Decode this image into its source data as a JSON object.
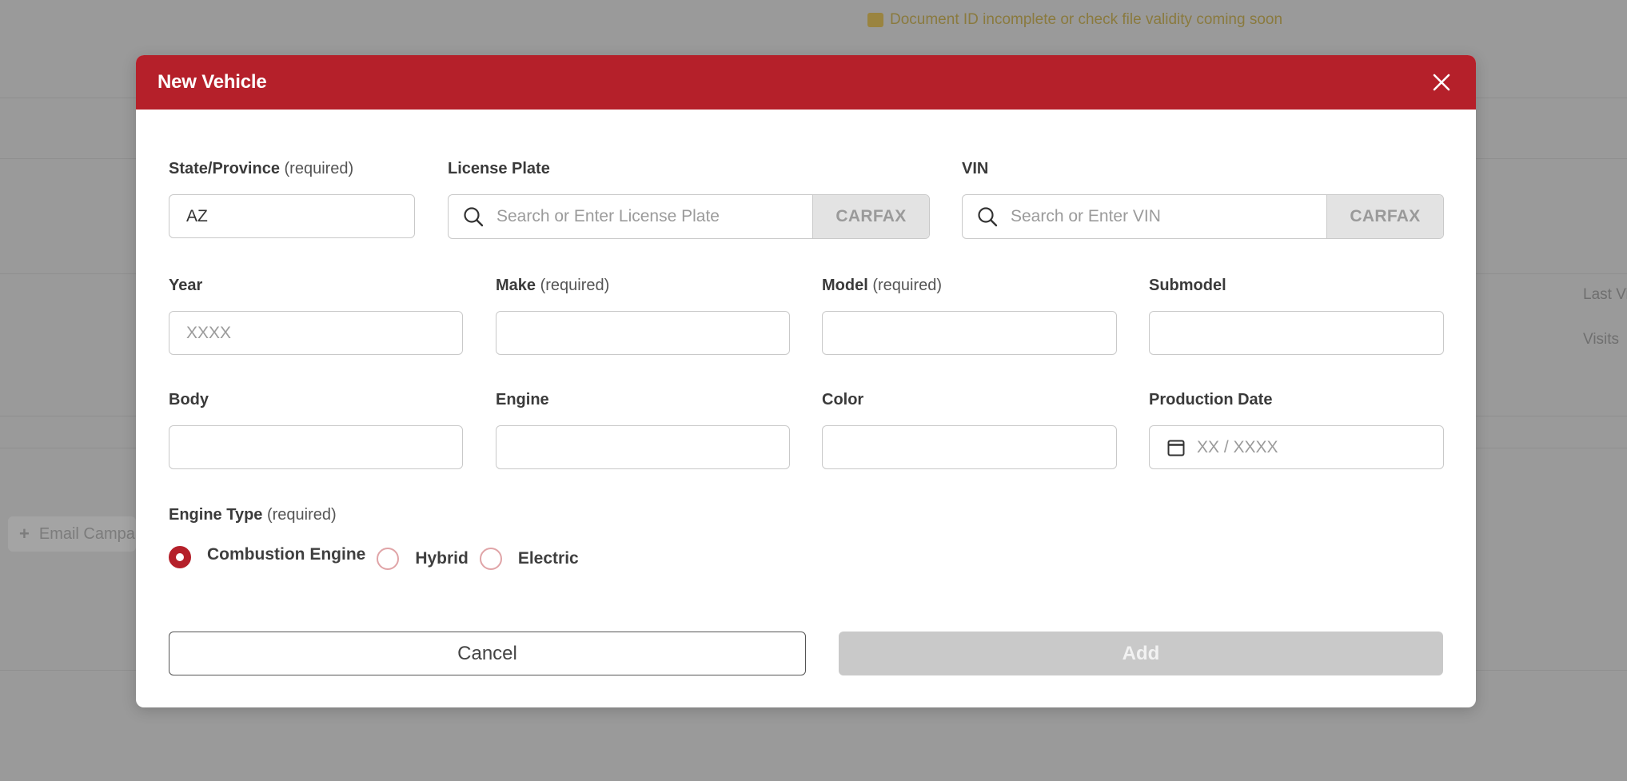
{
  "backdrop": {
    "banner_text": "Document ID incomplete or check file validity coming soon",
    "side_text_1": "Last Vi",
    "side_text_2": "Visits",
    "chip_label": "Email Campaign"
  },
  "modal": {
    "title": "New Vehicle",
    "fields": {
      "state": {
        "label": "State/Province",
        "required": "(required)",
        "value": "AZ"
      },
      "license_plate": {
        "label": "License Plate",
        "placeholder": "Search or Enter License Plate",
        "button": "CARFAX"
      },
      "vin": {
        "label": "VIN",
        "placeholder": "Search or Enter VIN",
        "button": "CARFAX"
      },
      "year": {
        "label": "Year",
        "placeholder": "XXXX"
      },
      "make": {
        "label": "Make",
        "required": "(required)"
      },
      "model": {
        "label": "Model",
        "required": "(required)"
      },
      "submodel": {
        "label": "Submodel"
      },
      "body": {
        "label": "Body"
      },
      "engine": {
        "label": "Engine"
      },
      "color": {
        "label": "Color"
      },
      "production_date": {
        "label": "Production Date",
        "placeholder": "XX / XXXX"
      }
    },
    "engine_type": {
      "label": "Engine Type",
      "required": "(required)",
      "options": [
        "Combustion Engine",
        "Hybrid",
        "Electric"
      ],
      "selected": "Combustion Engine"
    },
    "buttons": {
      "cancel": "Cancel",
      "add": "Add"
    }
  },
  "colors": {
    "brand_red": "#b5202a",
    "disabled_button": "#c9c9c9",
    "overlay": "#9a9a9a"
  }
}
